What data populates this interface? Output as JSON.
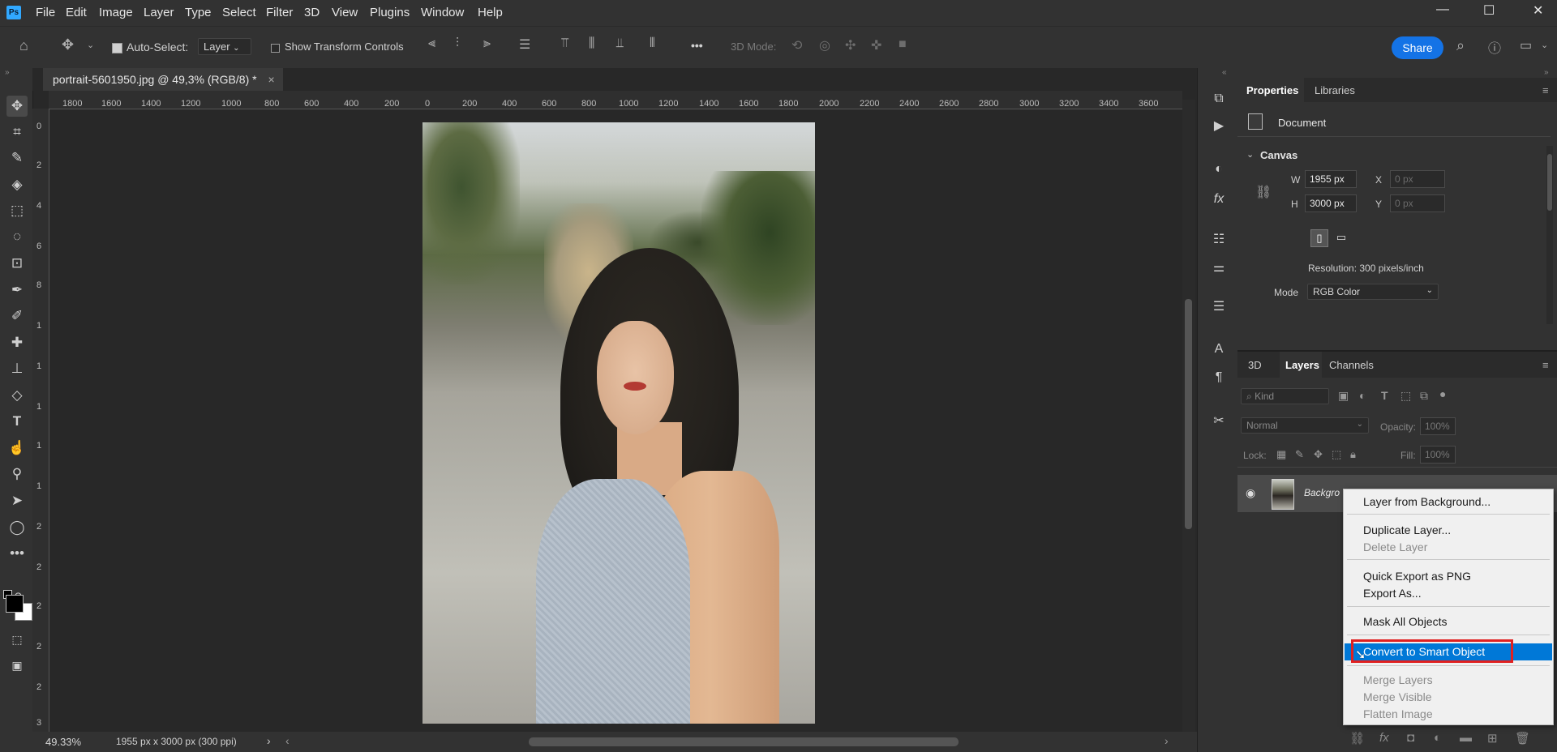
{
  "app": {
    "logo": "Ps"
  },
  "menubar": {
    "items": [
      "File",
      "Edit",
      "Image",
      "Layer",
      "Type",
      "Select",
      "Filter",
      "3D",
      "View",
      "Plugins",
      "Window",
      "Help"
    ],
    "minimize": "—",
    "maximize": "☐",
    "close": "✕"
  },
  "options": {
    "auto_select_label": "Auto-Select:",
    "auto_select_value": "Layer",
    "show_transform_label": "Show Transform Controls",
    "mode_3d_label": "3D Mode:",
    "more": "•••",
    "share_label": "Share"
  },
  "document": {
    "tab_title": "portrait-5601950.jpg @ 49,3% (RGB/8) *",
    "tab_close": "×",
    "hruler_ticks": [
      "1800",
      "1600",
      "1400",
      "1200",
      "1000",
      "800",
      "600",
      "400",
      "200",
      "0",
      "200",
      "400",
      "600",
      "800",
      "1000",
      "1200",
      "1400",
      "1600",
      "1800",
      "2000",
      "2200",
      "2400",
      "2600",
      "2800",
      "3000",
      "3200",
      "3400",
      "3600"
    ],
    "vruler_ticks": [
      "0",
      "2",
      "4",
      "6",
      "8",
      "1",
      "1",
      "1",
      "1",
      "1",
      "2",
      "2",
      "2",
      "2",
      "2",
      "3"
    ]
  },
  "statusbar": {
    "zoom": "49.33%",
    "doc_info": "1955 px x 3000 px (300 ppi)",
    "arrow": "›",
    "left_arrow": "‹",
    "right_arrow": "›"
  },
  "properties": {
    "tabs": [
      "Properties",
      "Libraries"
    ],
    "doc_label": "Document",
    "canvas_label": "Canvas",
    "w_label": "W",
    "w_value": "1955 px",
    "h_label": "H",
    "h_value": "3000 px",
    "x_label": "X",
    "x_placeholder": "0 px",
    "y_label": "Y",
    "y_placeholder": "0 px",
    "resolution": "Resolution: 300 pixels/inch",
    "mode_label": "Mode",
    "mode_value": "RGB Color"
  },
  "layers": {
    "tabs": [
      "3D",
      "Layers",
      "Channels"
    ],
    "kind_label": "Kind",
    "blend_mode": "Normal",
    "opacity_label": "Opacity:",
    "opacity_value": "100%",
    "lock_label": "Lock:",
    "fill_label": "Fill:",
    "fill_value": "100%",
    "layer_name": "Backgro"
  },
  "context_menu": {
    "items": [
      {
        "label": "Layer from Background...",
        "enabled": true
      },
      {
        "label": "Duplicate Layer...",
        "enabled": true
      },
      {
        "label": "Delete Layer",
        "enabled": false
      },
      {
        "label": "Quick Export as PNG",
        "enabled": true
      },
      {
        "label": "Export As...",
        "enabled": true
      },
      {
        "label": "Mask All Objects",
        "enabled": true
      },
      {
        "label": "Convert to Smart Object",
        "enabled": true,
        "highlighted": true
      },
      {
        "label": "Merge Layers",
        "enabled": false
      },
      {
        "label": "Merge Visible",
        "enabled": false
      },
      {
        "label": "Flatten Image",
        "enabled": false
      }
    ]
  },
  "colors": {
    "accent": "#1473e6",
    "highlight": "#0078d7",
    "annotation": "#e02020"
  }
}
